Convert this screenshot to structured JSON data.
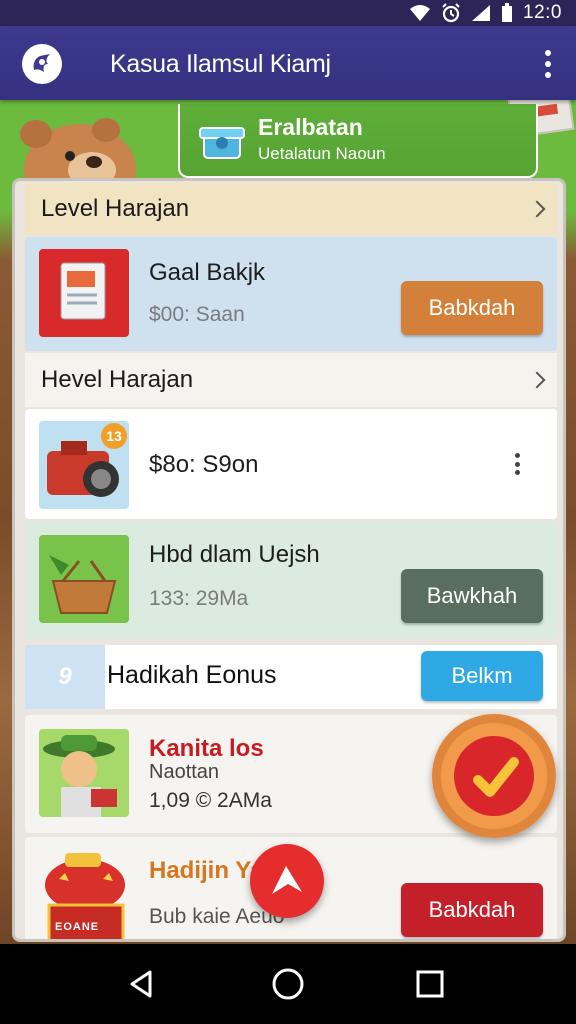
{
  "status_bar": {
    "time": "12:0",
    "icons": [
      "wifi-icon",
      "alarm-icon",
      "signal-icon",
      "battery-icon"
    ]
  },
  "app_bar": {
    "title": "Kasua Ilamsul Kiamj",
    "logo_icon": "app-logo-icon",
    "menu_icon": "overflow-menu-icon"
  },
  "promo": {
    "title": "Eralbatan",
    "subtitle": "Uetalatun Naoun",
    "icon": "gift-box-icon"
  },
  "sections": [
    {
      "label": "Level Harajan",
      "chevron_icon": "chevron-right-icon"
    },
    {
      "label": "Hevel Harajan",
      "chevron_icon": "chevron-right-icon"
    }
  ],
  "cards": {
    "gaal": {
      "title": "Gaal Bakjk",
      "meta": "$00: Saan",
      "button": "Babkdah",
      "icon": "document-icon"
    },
    "camera": {
      "meta": "$8o: S9on",
      "badge": "13",
      "icon": "camera-icon"
    },
    "hbd": {
      "title": "Hbd dlam Uejsh",
      "meta": "133: 29Ma",
      "button": "Bawkhah",
      "icon": "basket-icon"
    },
    "bonus": {
      "prefix": "9",
      "title": "Hadikah Eonus",
      "button": "Belkm"
    },
    "kanita": {
      "title": "Kanita los",
      "sub": "Naottan",
      "meta": "1,09  ©  2AMa",
      "icon": "character-icon"
    },
    "hadijin": {
      "title": "Hadijin Ya",
      "meta": "Bub kaie Aeuo",
      "button": "Babkdah",
      "label_on_pot": "EOANE",
      "icon": "treasure-pot-icon"
    }
  },
  "fabs": {
    "badge_icon": "check-seal-icon",
    "red_icon": "arrow-icon"
  },
  "nav": {
    "back": "back-icon",
    "home": "home-icon",
    "recents": "recents-icon"
  },
  "colors": {
    "appbar": "#3d3a8f",
    "orange_button": "#d3803a",
    "gray_button": "#596e5f",
    "blue_button": "#2fa8e6",
    "red_button": "#c32029",
    "card_title_red": "#c41c24",
    "card_title_orange": "#d4771e"
  }
}
